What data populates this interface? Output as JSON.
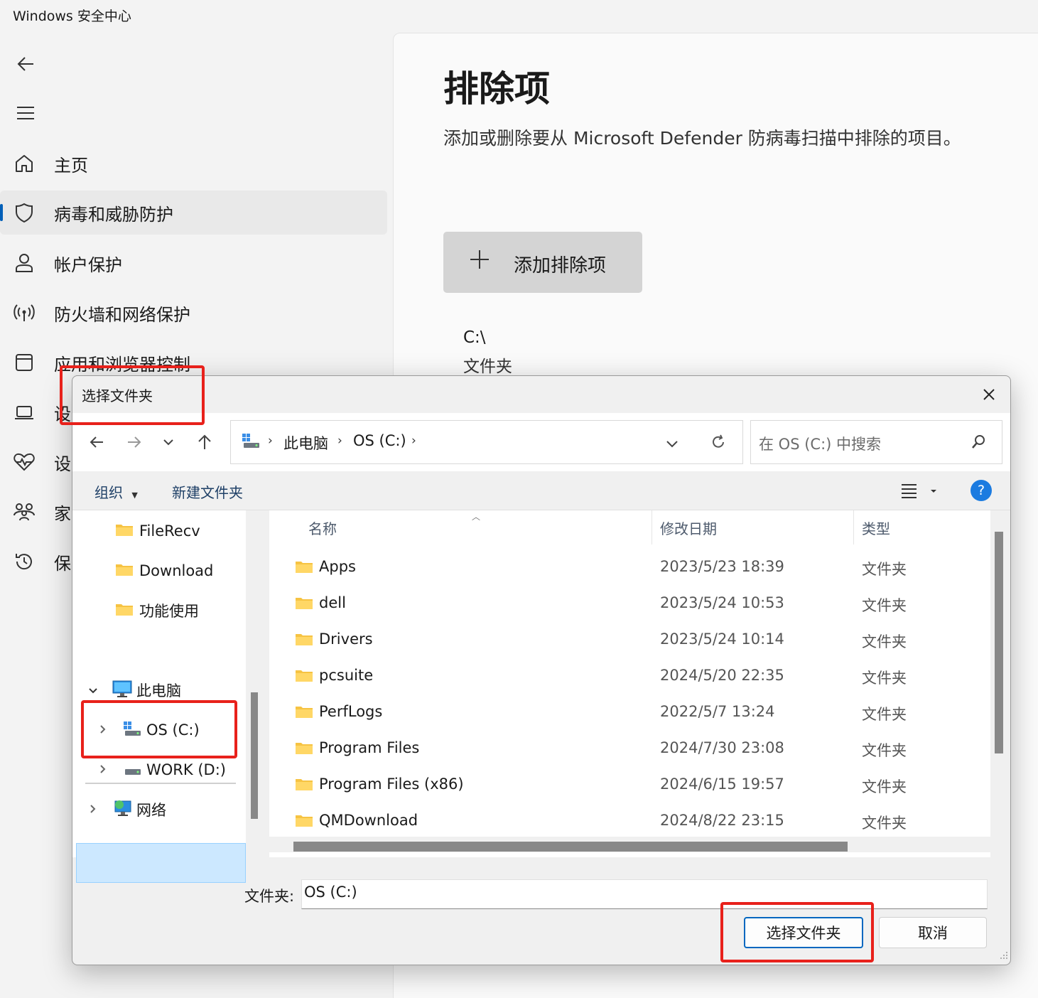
{
  "app": {
    "title": "Windows 安全中心",
    "sidebar": {
      "items": [
        {
          "label": "主页",
          "icon": "home-icon"
        },
        {
          "label": "病毒和威胁防护",
          "icon": "shield-icon"
        },
        {
          "label": "帐户保护",
          "icon": "person-icon"
        },
        {
          "label": "防火墙和网络保护",
          "icon": "wifi-signal-icon"
        },
        {
          "label": "应用和浏览器控制",
          "icon": "app-window-icon"
        },
        {
          "label": "设",
          "icon": "laptop-icon"
        },
        {
          "label": "设",
          "icon": "heart-pulse-icon"
        },
        {
          "label": "家",
          "icon": "family-icon"
        },
        {
          "label": "保",
          "icon": "history-icon"
        }
      ]
    },
    "main": {
      "title": "排除项",
      "description": "添加或删除要从 Microsoft Defender 防病毒扫描中排除的项目。",
      "add_button": "添加排除项",
      "exclusion": {
        "path": "C:\\",
        "type": "文件夹"
      }
    }
  },
  "dialog": {
    "title": "选择文件夹",
    "breadcrumb": [
      "此电脑",
      "OS (C:)"
    ],
    "search_placeholder": "在 OS (C:) 中搜索",
    "toolbar": {
      "organize": "组织",
      "new_folder": "新建文件夹",
      "help": "?"
    },
    "tree": {
      "quick": [
        "FileRecv",
        "Download",
        "功能使用"
      ],
      "this_pc": "此电脑",
      "drives": [
        "OS (C:)",
        "WORK (D:)"
      ],
      "network": "网络"
    },
    "columns": {
      "name": "名称",
      "date": "修改日期",
      "type": "类型"
    },
    "rows": [
      {
        "name": "Apps",
        "date": "2023/5/23 18:39",
        "type": "文件夹"
      },
      {
        "name": "dell",
        "date": "2023/5/24 10:53",
        "type": "文件夹"
      },
      {
        "name": "Drivers",
        "date": "2023/5/24 10:14",
        "type": "文件夹"
      },
      {
        "name": "pcsuite",
        "date": "2024/5/20 22:35",
        "type": "文件夹"
      },
      {
        "name": "PerfLogs",
        "date": "2022/5/7 13:24",
        "type": "文件夹"
      },
      {
        "name": "Program Files",
        "date": "2024/7/30 23:08",
        "type": "文件夹"
      },
      {
        "name": "Program Files (x86)",
        "date": "2024/6/15 19:57",
        "type": "文件夹"
      },
      {
        "name": "QMDownload",
        "date": "2024/8/22 23:15",
        "type": "文件夹"
      }
    ],
    "folder_label": "文件夹:",
    "folder_value": "OS (C:)",
    "select_button": "选择文件夹",
    "cancel_button": "取消"
  },
  "colors": {
    "accent": "#005fb8",
    "highlight": "#e8211b",
    "selection": "#cce8ff",
    "folder": "#f6c343"
  }
}
